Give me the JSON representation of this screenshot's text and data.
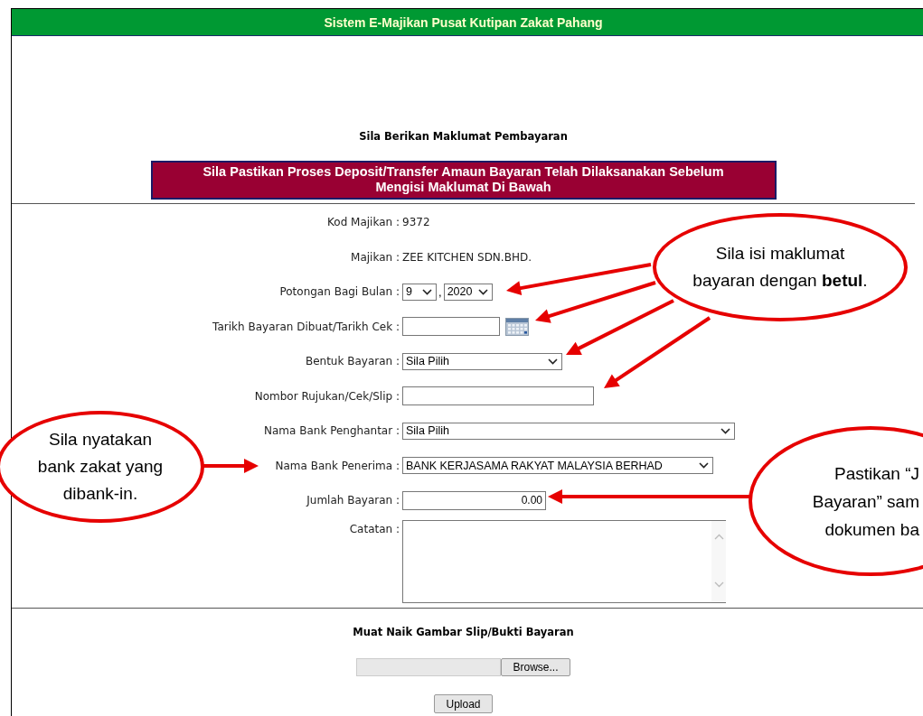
{
  "header": {
    "title": "Sistem E-Majikan Pusat Kutipan Zakat Pahang"
  },
  "section_title": "Sila Berikan Maklumat Pembayaran",
  "notice": "Sila Pastikan Proses Deposit/Transfer Amaun Bayaran Telah Dilaksanakan Sebelum Mengisi Maklumat Di Bawah",
  "fields": [
    {
      "label": "Kod Majikan :",
      "kind": "static",
      "value": "9372"
    },
    {
      "label": "Majikan :",
      "kind": "static",
      "value": "ZEE KITCHEN SDN.BHD."
    },
    {
      "label": "Potongan Bagi Bulan :",
      "kind": "month_year",
      "month": "9",
      "separator": ",",
      "year": "2020"
    },
    {
      "label": "Tarikh Bayaran Dibuat/Tarikh Cek :",
      "kind": "date"
    },
    {
      "label": "Bentuk Bayaran :",
      "kind": "select",
      "value": "Sila Pilih"
    },
    {
      "label": "Nombor Rujukan/Cek/Slip :",
      "kind": "text"
    },
    {
      "label": "Nama Bank Penghantar :",
      "kind": "select",
      "value": "Sila Pilih"
    },
    {
      "label": "Nama Bank Penerima :",
      "kind": "select",
      "value": "BANK KERJASAMA RAKYAT MALAYSIA BERHAD"
    },
    {
      "label": "Jumlah Bayaran :",
      "kind": "amount",
      "value": "0.00"
    },
    {
      "label": "Catatan :",
      "kind": "textarea"
    }
  ],
  "upload": {
    "title": "Muat Naik Gambar Slip/Bukti Bayaran",
    "browse_button": "Browse...",
    "upload_button": "Upload"
  },
  "callouts": [
    {
      "lines": [
        "Sila isi maklumat",
        "bayaran dengan **betul**."
      ]
    },
    {
      "lines": [
        "Sila nyatakan",
        "bank zakat yang",
        "dibank-in."
      ]
    },
    {
      "lines": [
        "Pastikan “J",
        "Bayaran” sam",
        "dokumen ba"
      ]
    }
  ]
}
